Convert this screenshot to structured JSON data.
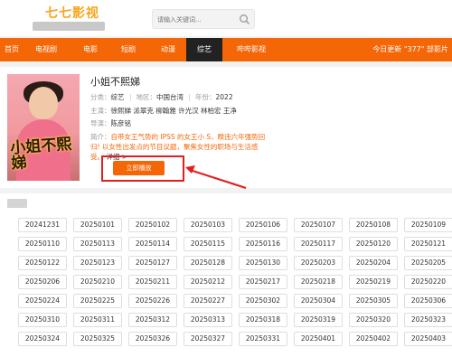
{
  "header": {
    "logo_text": "七七影视",
    "search_placeholder": "请输入关键词..."
  },
  "nav": {
    "items": [
      "首页",
      "电视剧",
      "电影",
      "短剧",
      "动漫",
      "综艺",
      "哔哔影视"
    ],
    "active": "综艺",
    "today_update": "今日更新 \"377\" 部影片"
  },
  "show": {
    "title": "小姐不熙娣",
    "poster_text": "小姐不熙娣",
    "category_label": "分类：",
    "category": "综艺",
    "region_label": "地区：",
    "region": "中国台湾",
    "year_label": "年份：",
    "year": "2022",
    "cast_label": "主演：",
    "cast": "徐熙娣 派翠克 柳翰雅 许光汉 林柏宏 王净",
    "director_label": "导演：",
    "director": "陈彦铭",
    "intro_label": "简介：",
    "intro": "自带女王气势的 IPSS 的女王小 S，睽违六年强势回归! 以女性出发点的节目议题，聚焦女性的职场与生活感受。",
    "intro_more": "详细 >",
    "play_button": "立即播放"
  },
  "episodes": {
    "items": [
      "20241231",
      "20250101",
      "20250102",
      "20250103",
      "20250106",
      "20250107",
      "20250108",
      "20250109",
      "20250110",
      "20250113",
      "20250114",
      "20250115",
      "20250116",
      "20250117",
      "20250120",
      "20250121",
      "20250122",
      "20250123",
      "20250127",
      "20250128",
      "20250130",
      "20250203",
      "20250204",
      "20250205",
      "20250206",
      "20250210",
      "20250211",
      "20250212",
      "20250217",
      "20250218",
      "20250219",
      "20250220",
      "20250224",
      "20250225",
      "20250226",
      "20250227",
      "20250302",
      "20250304",
      "20250305",
      "20250306",
      "20250310",
      "20250311",
      "20250312",
      "20250313",
      "20250318",
      "20250319",
      "20250320",
      "20250323",
      "20250324",
      "20250325",
      "20250326",
      "20250327",
      "20250331",
      "20250401",
      "20250402",
      "20250403"
    ]
  },
  "colors": {
    "accent": "#f56607",
    "nav_active": "#222222",
    "highlight_box": "#e02020"
  }
}
